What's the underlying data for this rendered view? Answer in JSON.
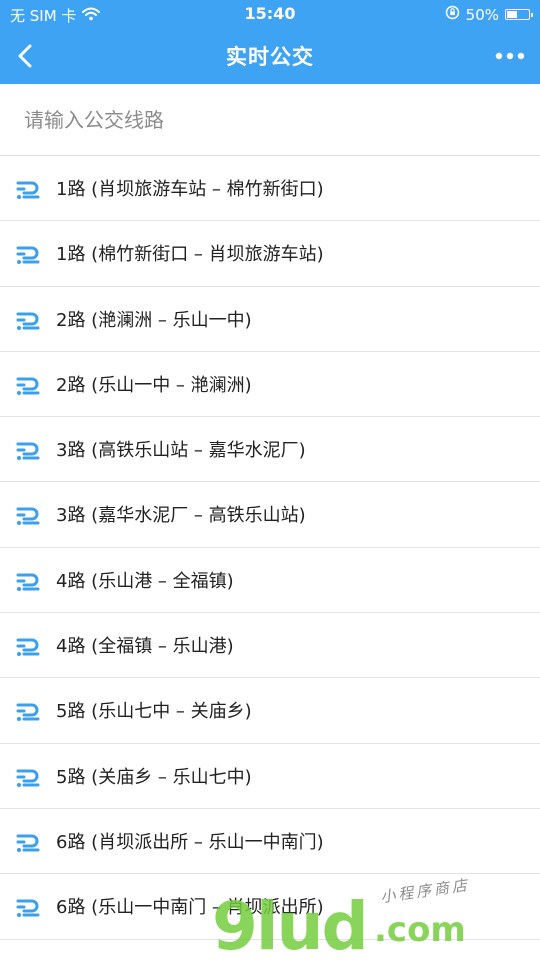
{
  "status_bar": {
    "carrier": "无 SIM 卡",
    "time": "15:40",
    "battery_text": "50%",
    "battery_level": 0.5
  },
  "nav": {
    "title": "实时公交"
  },
  "search": {
    "placeholder": "请输入公交线路",
    "value": ""
  },
  "routes": [
    "1路 (肖坝旅游车站 – 棉竹新街口)",
    "1路 (棉竹新街口 – 肖坝旅游车站)",
    "2路 (滟澜洲 – 乐山一中)",
    "2路 (乐山一中 – 滟澜洲)",
    "3路 (高铁乐山站 – 嘉华水泥厂)",
    "3路 (嘉华水泥厂 – 高铁乐山站)",
    "4路 (乐山港 – 全福镇)",
    "4路 (全福镇 – 乐山港)",
    "5路 (乐山七中 – 关庙乡)",
    "5路 (关庙乡 – 乐山七中)",
    "6路 (肖坝派出所 – 乐山一中南门)",
    "6路 (乐山一中南门 – 肖坝派出所)"
  ],
  "watermark": {
    "big": "9lud",
    "small": "小程序商店",
    "dotcom": ".com"
  },
  "colors": {
    "header_blue": "#3fa3f3",
    "route_icon_blue": "#3aa0ee",
    "watermark_green": "#74cc3e"
  },
  "icons": {
    "back": "chevron-left-icon",
    "more": "more-dots-icon",
    "route": "bus-route-icon",
    "wifi": "wifi-icon",
    "orientation_lock": "orientation-lock-icon",
    "battery": "battery-icon"
  }
}
